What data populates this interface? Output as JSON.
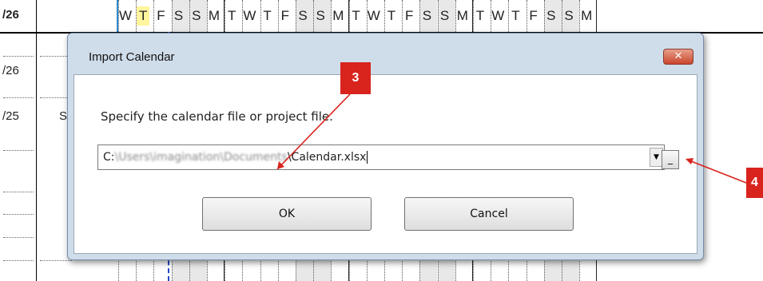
{
  "sheet": {
    "dates": [
      "/26",
      "/26",
      "/25"
    ],
    "row_letter": "S",
    "days": [
      "W",
      "T",
      "F",
      "S",
      "S",
      "M",
      "T",
      "W",
      "T",
      "F",
      "S",
      "S",
      "M",
      "T",
      "W",
      "T",
      "F",
      "S",
      "S",
      "M",
      "T",
      "W",
      "T",
      "F",
      "S",
      "S",
      "M"
    ]
  },
  "dialog": {
    "title": "Import Calendar",
    "close_label": "✕",
    "prompt": "Specify the calendar file or project file.",
    "path_prefix": "C:",
    "path_blurred": "\\Users\\imagination\\Documents",
    "path_suffix": "\\Calendar.xlsx",
    "combo_arrow": "▼",
    "browse_label": "_",
    "ok_label": "OK",
    "cancel_label": "Cancel"
  },
  "annotations": {
    "callout_3": "3",
    "callout_4": "4",
    "color": "#d9231d"
  },
  "colors": {
    "header_blue": "#2a8bd2",
    "dialog_frame": "#cfdcea",
    "today_line": "#2244cc",
    "highlight": "#fff59d"
  }
}
